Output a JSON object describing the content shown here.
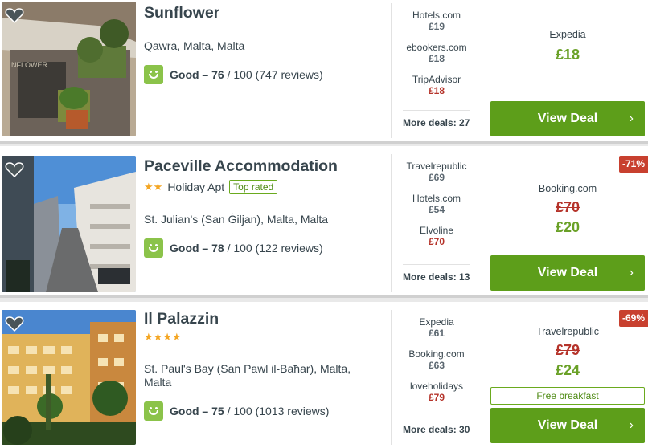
{
  "hotels": [
    {
      "name": "Sunflower",
      "stars": "",
      "type": "",
      "top_rated": "",
      "location": "Qawra, Malta, Malta",
      "rating_label": "Good – 76",
      "rating_rest": "/ 100 (747 reviews)",
      "partners": [
        {
          "site": "Hotels.com",
          "price": "£19",
          "highlight": false
        },
        {
          "site": "ebookers.com",
          "price": "£18",
          "highlight": false
        },
        {
          "site": "TripAdvisor",
          "price": "£18",
          "highlight": true
        }
      ],
      "more_deals": "More deals: 27",
      "deal_site": "Expedia",
      "old_price": "",
      "price": "£18",
      "discount": "",
      "extra": "",
      "button": "View Deal"
    },
    {
      "name": "Paceville Accommodation",
      "stars": "★★",
      "type": "Holiday Apt",
      "top_rated": "Top rated",
      "location": "St. Julian's (San Ġiljan), Malta, Malta",
      "rating_label": "Good – 78",
      "rating_rest": "/ 100 (122 reviews)",
      "partners": [
        {
          "site": "Travelrepublic",
          "price": "£69",
          "highlight": false
        },
        {
          "site": "Hotels.com",
          "price": "£54",
          "highlight": false
        },
        {
          "site": "Elvoline",
          "price": "£70",
          "highlight": true
        }
      ],
      "more_deals": "More deals: 13",
      "deal_site": "Booking.com",
      "old_price": "£70",
      "price": "£20",
      "discount": "-71%",
      "extra": "",
      "button": "View Deal"
    },
    {
      "name": "Il Palazzin",
      "stars": "★★★★",
      "type": "",
      "top_rated": "",
      "location": "St. Paul's Bay (San Pawl il-Baħar), Malta, Malta",
      "rating_label": "Good – 75",
      "rating_rest": "/ 100 (1013 reviews)",
      "partners": [
        {
          "site": "Expedia",
          "price": "£61",
          "highlight": false
        },
        {
          "site": "Booking.com",
          "price": "£63",
          "highlight": false
        },
        {
          "site": "loveholidays",
          "price": "£79",
          "highlight": true
        }
      ],
      "more_deals": "More deals: 30",
      "deal_site": "Travelrepublic",
      "old_price": "£79",
      "price": "£24",
      "discount": "-69%",
      "extra": "Free breakfast",
      "button": "View Deal"
    }
  ],
  "colors": {
    "button": "#5d9e1a",
    "price_green": "#6aa127",
    "price_red": "#b5332a",
    "discount_bg": "#c8402f",
    "rating_green": "#8bc34a",
    "stars": "#f4a623"
  },
  "icons": {
    "favorite": "heart-icon",
    "rating": "smiley-icon",
    "chevron": "chevron-right-icon"
  }
}
